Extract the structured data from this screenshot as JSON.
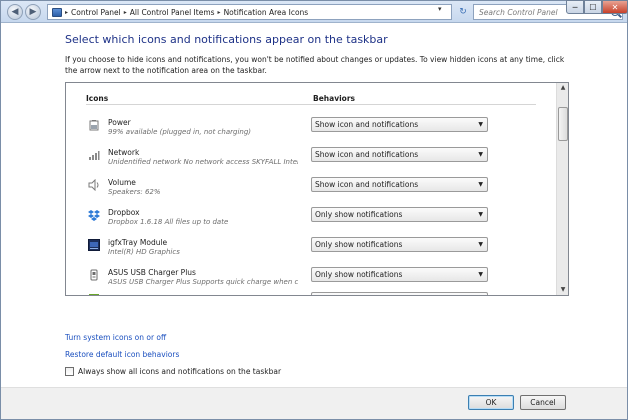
{
  "window": {
    "address": [
      "Control Panel",
      "All Control Panel Items",
      "Notification Area Icons"
    ],
    "search_placeholder": "Search Control Panel",
    "min_label": "─",
    "max_label": "☐",
    "close_label": "✕",
    "back_label": "◀",
    "fwd_label": "▶",
    "sep": "▸",
    "dropdown_arrow": "▾",
    "refresh_label": "↻"
  },
  "main": {
    "heading": "Select which icons and notifications appear on the taskbar",
    "description": "If you choose to hide icons and notifications, you won't be notified about changes or updates. To view hidden icons at any time, click the arrow next to the notification area on the taskbar.",
    "col_icons": "Icons",
    "col_behaviors": "Behaviors",
    "rows": [
      {
        "icon": "power-icon",
        "name": "Power",
        "sub": "99% available (plugged in, not charging)",
        "behavior": "Show icon and notifications"
      },
      {
        "icon": "network-icon",
        "name": "Network",
        "sub": "Unidentified network No network access SKYFALL Intern...",
        "behavior": "Show icon and notifications"
      },
      {
        "icon": "volume-icon",
        "name": "Volume",
        "sub": "Speakers: 62%",
        "behavior": "Show icon and notifications"
      },
      {
        "icon": "dropbox-icon",
        "name": "Dropbox",
        "sub": "Dropbox 1.6.18 All files up to date",
        "behavior": "Only show notifications"
      },
      {
        "icon": "intel-graphics-icon",
        "name": "igfxTray Module",
        "sub": "Intel(R) HD Graphics",
        "behavior": "Only show notifications"
      },
      {
        "icon": "usb-charger-icon",
        "name": "ASUS USB Charger Plus",
        "sub": "ASUS USB Charger Plus Supports quick charge when co...",
        "behavior": "Only show notifications"
      }
    ],
    "link_turn_system_icons": "Turn system icons on or off",
    "link_restore_defaults": "Restore default icon behaviors",
    "checkbox_always_show": "Always show all icons and notifications on the taskbar",
    "checkbox_always_show_checked": false
  },
  "footer": {
    "ok": "OK",
    "cancel": "Cancel"
  },
  "colors": {
    "heading": "#1e3287",
    "link": "#1a4fbf"
  }
}
